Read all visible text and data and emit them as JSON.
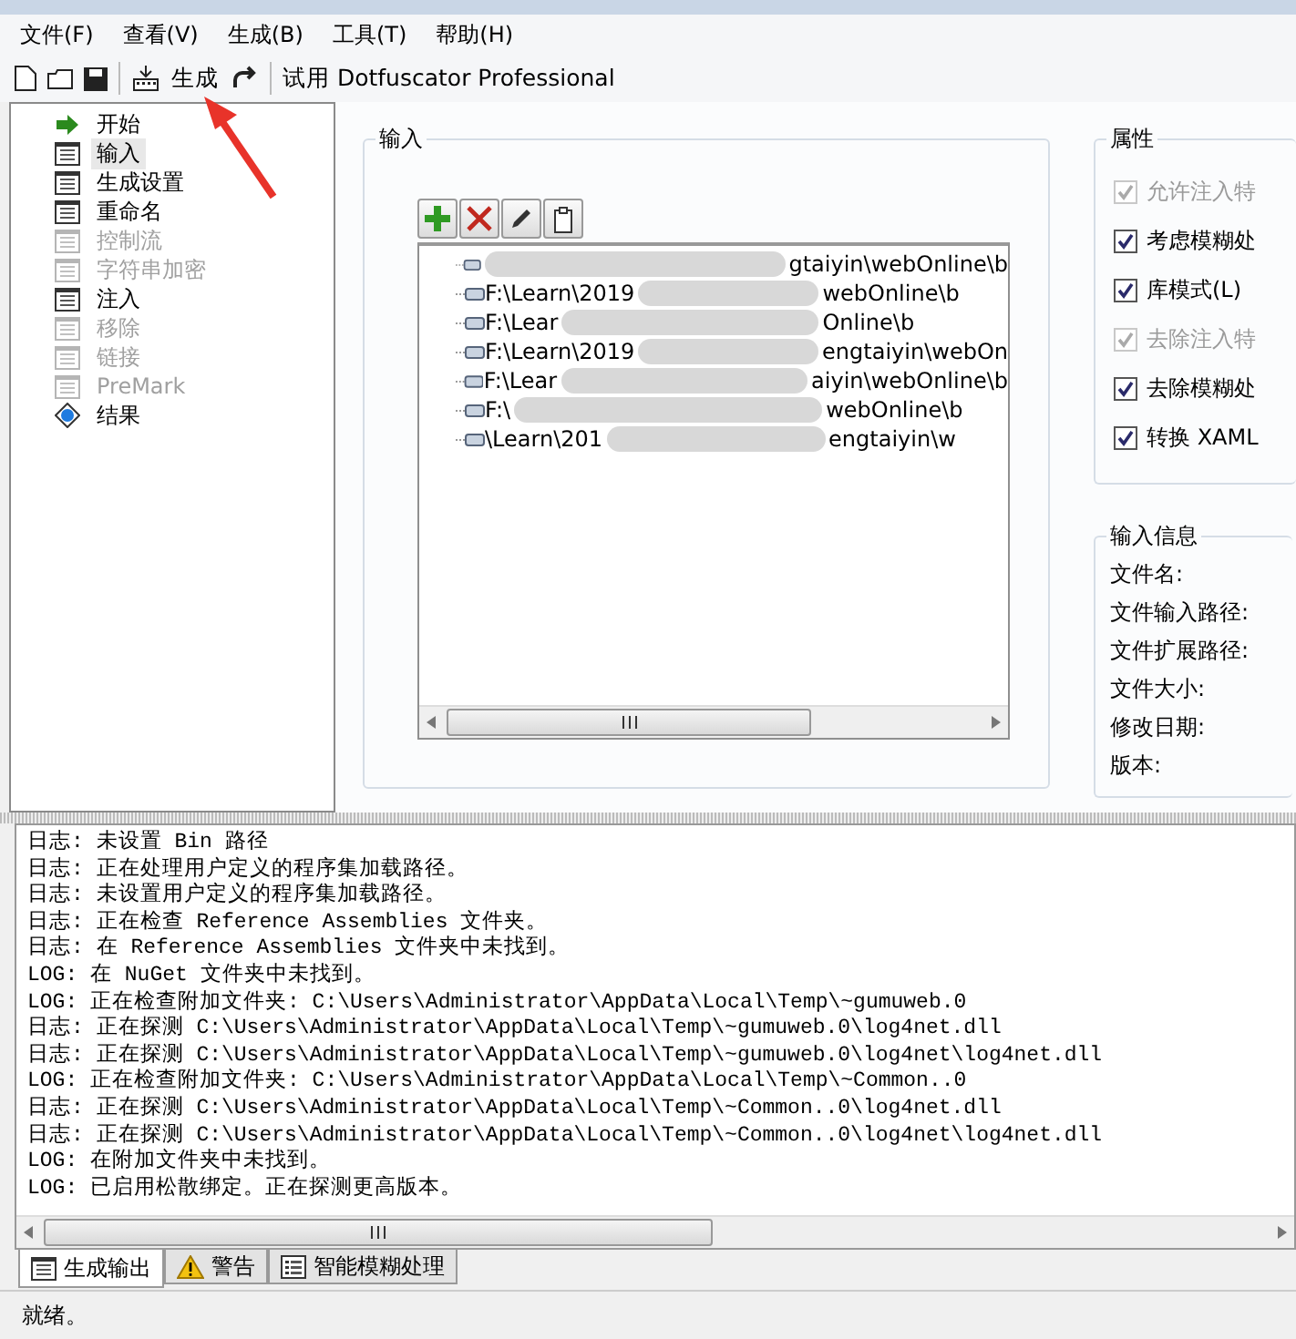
{
  "menu": [
    {
      "label": "文件(F)"
    },
    {
      "label": "查看(V)"
    },
    {
      "label": "生成(B)"
    },
    {
      "label": "工具(T)"
    },
    {
      "label": "帮助(H)"
    }
  ],
  "toolbar": {
    "build_label": "生成",
    "trial_label": "试用 Dotfuscator Professional"
  },
  "nav": [
    {
      "label": "开始",
      "kind": "start",
      "disabled": false,
      "selected": false
    },
    {
      "label": "输入",
      "kind": "page",
      "disabled": false,
      "selected": true
    },
    {
      "label": "生成设置",
      "kind": "page",
      "disabled": false,
      "selected": false
    },
    {
      "label": "重命名",
      "kind": "page",
      "disabled": false,
      "selected": false
    },
    {
      "label": "控制流",
      "kind": "page",
      "disabled": true,
      "selected": false
    },
    {
      "label": "字符串加密",
      "kind": "page",
      "disabled": true,
      "selected": false
    },
    {
      "label": "注入",
      "kind": "page",
      "disabled": false,
      "selected": false
    },
    {
      "label": "移除",
      "kind": "page",
      "disabled": true,
      "selected": false
    },
    {
      "label": "链接",
      "kind": "page",
      "disabled": true,
      "selected": false
    },
    {
      "label": "PreMark",
      "kind": "page",
      "disabled": true,
      "selected": false
    },
    {
      "label": "结果",
      "kind": "result",
      "disabled": false,
      "selected": false
    }
  ],
  "input_group": {
    "title": "输入",
    "files": [
      {
        "right": "gtaiyin\\webOnline\\b"
      },
      {
        "left": "F:\\Learn\\2019",
        "right": "webOnline\\b"
      },
      {
        "left": "F:\\Lear",
        "right": "Online\\b"
      },
      {
        "left": "F:\\Learn\\2019",
        "right": "engtaiyin\\webOn"
      },
      {
        "left": "F:\\Lear",
        "right": "aiyin\\webOnline\\b"
      },
      {
        "left": "F:\\",
        "right": "webOnline\\b"
      },
      {
        "left": "\\Learn\\201",
        "right": "engtaiyin\\w"
      }
    ]
  },
  "properties": {
    "title": "属性",
    "options": [
      {
        "label": "允许注入特",
        "checked": true,
        "disabled": true
      },
      {
        "label": "考虑模糊处",
        "checked": true,
        "disabled": false
      },
      {
        "label": "库模式(L)",
        "checked": true,
        "disabled": false
      },
      {
        "label": "去除注入特",
        "checked": true,
        "disabled": true
      },
      {
        "label": "去除模糊处",
        "checked": true,
        "disabled": false
      },
      {
        "label": "转换 XAML",
        "checked": true,
        "disabled": false
      }
    ]
  },
  "input_info": {
    "title": "输入信息",
    "fields": [
      "文件名:",
      "文件输入路径:",
      "文件扩展路径:",
      "文件大小:",
      "修改日期:",
      "版本:"
    ]
  },
  "log": {
    "lines": [
      "日志: 未设置 Bin 路径",
      "日志: 正在处理用户定义的程序集加载路径。",
      "日志: 未设置用户定义的程序集加载路径。",
      "日志: 正在检查 Reference Assemblies 文件夹。",
      "日志: 在 Reference Assemblies 文件夹中未找到。",
      "LOG: 在 NuGet 文件夹中未找到。",
      "LOG: 正在检查附加文件夹: C:\\Users\\Administrator\\AppData\\Local\\Temp\\~gumuweb.0",
      "日志: 正在探测 C:\\Users\\Administrator\\AppData\\Local\\Temp\\~gumuweb.0\\log4net.dll",
      "日志: 正在探测 C:\\Users\\Administrator\\AppData\\Local\\Temp\\~gumuweb.0\\log4net\\log4net.dll",
      "LOG: 正在检查附加文件夹: C:\\Users\\Administrator\\AppData\\Local\\Temp\\~Common..0",
      "日志: 正在探测 C:\\Users\\Administrator\\AppData\\Local\\Temp\\~Common..0\\log4net.dll",
      "日志: 正在探测 C:\\Users\\Administrator\\AppData\\Local\\Temp\\~Common..0\\log4net\\log4net.dll",
      "LOG: 在附加文件夹中未找到。",
      "LOG: 已启用松散绑定。正在探测更高版本。"
    ]
  },
  "bottom_tabs": [
    {
      "label": "生成输出",
      "kind": "output",
      "selected": true
    },
    {
      "label": "警告",
      "kind": "warning",
      "selected": false
    },
    {
      "label": "智能模糊处理",
      "kind": "smart",
      "selected": false
    }
  ],
  "status": "就绪。"
}
